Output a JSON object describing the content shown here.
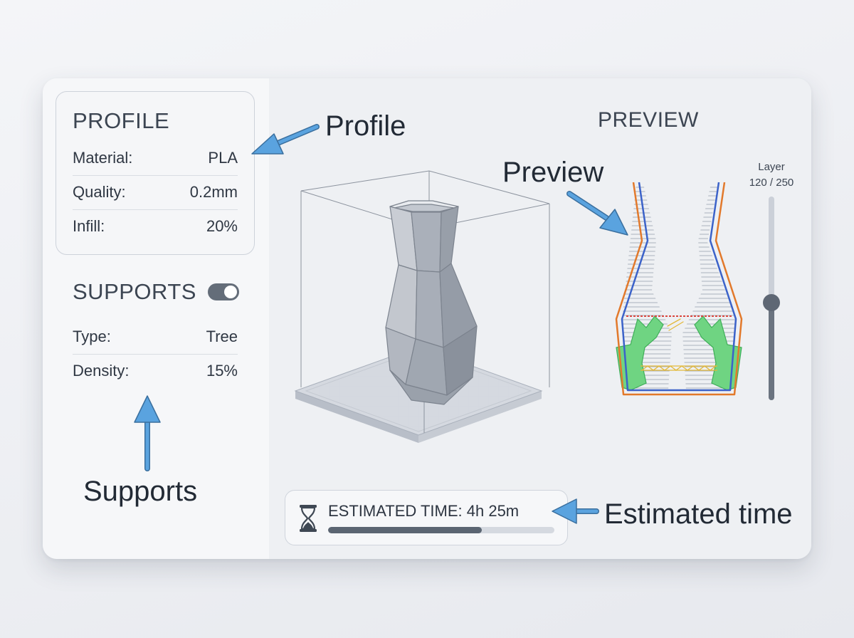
{
  "profile": {
    "title": "PROFILE",
    "rows": [
      {
        "label": "Material:",
        "value": "PLA"
      },
      {
        "label": "Quality:",
        "value": "0.2mm"
      },
      {
        "label": "Infill:",
        "value": "20%"
      }
    ]
  },
  "supports": {
    "title": "SUPPORTS",
    "enabled": true,
    "rows": [
      {
        "label": "Type:",
        "value": "Tree"
      },
      {
        "label": "Density:",
        "value": "15%"
      }
    ]
  },
  "preview": {
    "title": "PREVIEW",
    "layer_label": "Layer",
    "layer_readout": "120 / 250",
    "layer_current": 120,
    "layer_total": 250
  },
  "estimate": {
    "label": "ESTIMATED TIME: 4h 25m",
    "progress": 0.68
  },
  "annotations": {
    "profile": "Profile",
    "preview": "Preview",
    "supports": "Supports",
    "estimated_time": "Estimated time"
  },
  "icons": [
    "hourglass-icon",
    "toggle-switch"
  ],
  "colors": {
    "arrow": "#5aa3df",
    "outer_wall": "#e2792b",
    "inner_wall": "#3b62c9",
    "support": "#4fc46a",
    "infill": "#e3b93a",
    "current_layer": "#d9473f"
  }
}
